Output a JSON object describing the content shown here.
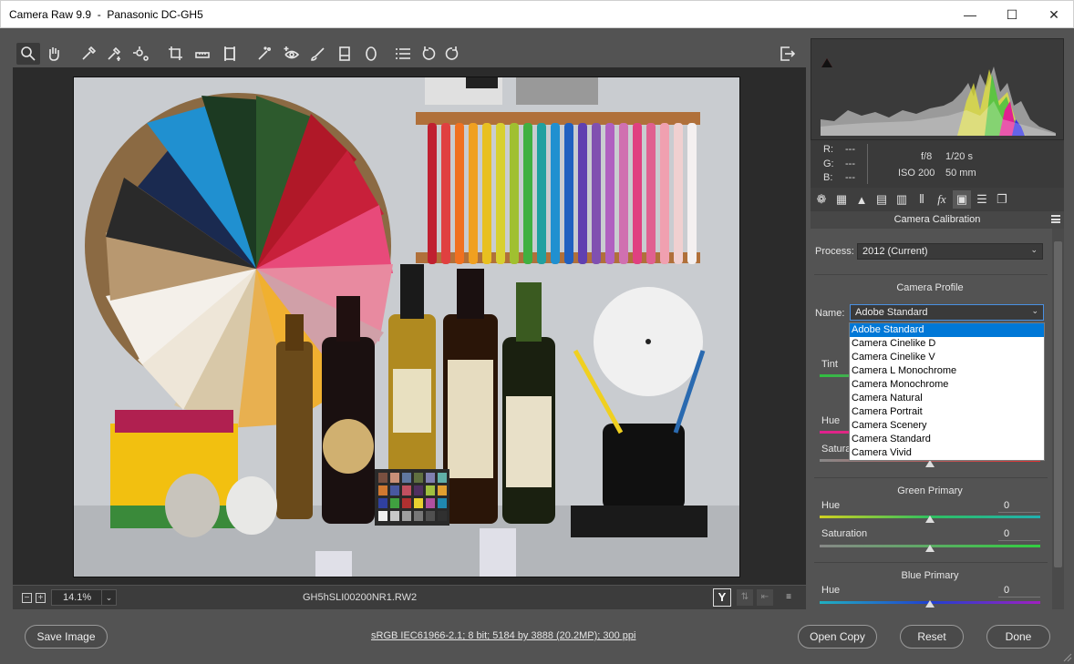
{
  "window": {
    "title": "Camera Raw 9.9  -  Panasonic DC-GH5",
    "minimize": "—",
    "maximize": "☐",
    "close": "✕"
  },
  "toolbar": {
    "tools": [
      "zoom-tool",
      "hand-tool",
      "white-balance-tool",
      "color-sampler-tool",
      "targeted-adjustment-tool",
      "crop-tool",
      "straighten-tool",
      "transform-tool",
      "spot-removal-tool",
      "red-eye-tool",
      "adjustment-brush",
      "graduated-filter",
      "radial-filter",
      "preferences",
      "rotate-left",
      "rotate-right"
    ]
  },
  "preview": {
    "zoom_value": "14.1%",
    "zoom_minus": "−",
    "zoom_plus": "+",
    "filename": "GH5hSLI00200NR1.RW2",
    "y_button": "Y"
  },
  "readout": {
    "r_label": "R:",
    "r_value": "---",
    "g_label": "G:",
    "g_value": "---",
    "b_label": "B:",
    "b_value": "---",
    "aperture": "f/8",
    "shutter": "1/20 s",
    "iso": "ISO 200",
    "focal": "50 mm"
  },
  "panel": {
    "title": "Camera Calibration",
    "process_label": "Process:",
    "process_value": "2012 (Current)",
    "camera_profile_title": "Camera Profile",
    "name_label": "Name:",
    "name_value": "Adobe Standard",
    "tint_label": "Tint",
    "red_hue_label": "Hue",
    "red_sat_label": "Saturation",
    "green_title": "Green Primary",
    "green_hue_label": "Hue",
    "green_hue_value": "0",
    "green_sat_label": "Saturation",
    "green_sat_value": "0",
    "blue_title": "Blue Primary",
    "blue_hue_label": "Hue",
    "blue_hue_value": "0"
  },
  "profile_options": [
    "Adobe Standard",
    "Camera Cinelike D",
    "Camera Cinelike V",
    "Camera L Monochrome",
    "Camera Monochrome",
    "Camera Natural",
    "Camera Portrait",
    "Camera Scenery",
    "Camera Standard",
    "Camera Vivid"
  ],
  "footer": {
    "save_image": "Save Image",
    "image_info": "sRGB IEC61966-2.1; 8 bit; 5184 by 3888 (20.2MP); 300 ppi",
    "open_copy": "Open Copy",
    "reset": "Reset",
    "done": "Done"
  }
}
